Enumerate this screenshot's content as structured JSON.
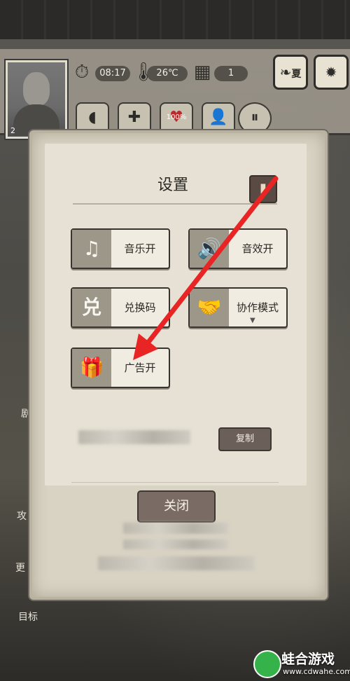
{
  "hud": {
    "time": "08:17",
    "temperature": "26℃",
    "day": "1",
    "level": "2",
    "season": "夏",
    "health": "100%"
  },
  "side_labels": {
    "label_1": "剧",
    "label_2": "攻",
    "label_3": "更",
    "label_4": "目标"
  },
  "settings": {
    "title": "设置",
    "options": [
      {
        "label": "音乐开",
        "icon": "music-note-icon"
      },
      {
        "label": "音效开",
        "icon": "speaker-icon"
      },
      {
        "label": "兑换码",
        "icon": "redeem-icon"
      },
      {
        "label": "协作模式",
        "icon": "handshake-icon"
      },
      {
        "label": "广告开",
        "icon": "gift-tv-icon"
      }
    ],
    "copy_label": "复制",
    "close_label": "关闭"
  },
  "watermark": {
    "name": "蛙合游戏",
    "url": "www.cdwahe.com"
  },
  "colors": {
    "arrow": "#e82424",
    "dialog_bg": "#e6e1d4",
    "icon_bg": "#9c9788"
  }
}
